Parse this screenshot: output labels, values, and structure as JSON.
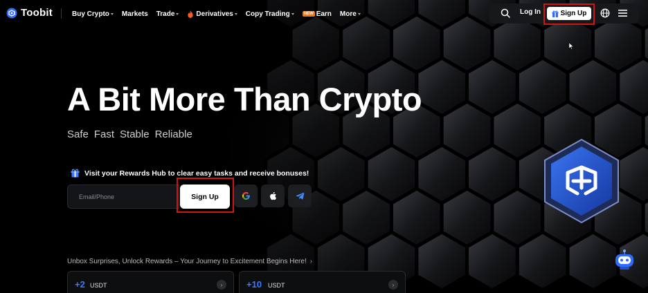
{
  "brand": {
    "name": "Toobit"
  },
  "nav": {
    "items": [
      {
        "label": "Buy Crypto",
        "has_caret": true
      },
      {
        "label": "Markets",
        "has_caret": false
      },
      {
        "label": "Trade",
        "has_caret": true
      },
      {
        "label": "Derivatives",
        "has_caret": true,
        "icon": "fire-icon"
      },
      {
        "label": "Copy Trading",
        "has_caret": true
      },
      {
        "label": "Earn",
        "has_caret": false,
        "badge": "NEW"
      },
      {
        "label": "More",
        "has_caret": true
      }
    ],
    "login_label": "Log In",
    "signup_label": "Sign Up"
  },
  "hero": {
    "title": "A Bit More Than Crypto",
    "tags": [
      "Safe",
      "Fast",
      "Stable",
      "Reliable"
    ],
    "rewards_text": "Visit your Rewards Hub to clear easy tasks and receive bonuses!",
    "email_placeholder": "Email/Phone",
    "signup_label": "Sign Up",
    "social": [
      "google-icon",
      "apple-icon",
      "telegram-icon"
    ]
  },
  "promo": {
    "headline": "Unbox Surprises, Unlock Rewards – Your Journey to Excitement Begins Here!",
    "cards": [
      {
        "amount": "+2",
        "unit": "USDT"
      },
      {
        "amount": "+10",
        "unit": "USDT"
      }
    ]
  },
  "colors": {
    "accent_blue": "#3d7bff",
    "highlight_red": "#d11515",
    "new_badge": "#f07a1a"
  }
}
